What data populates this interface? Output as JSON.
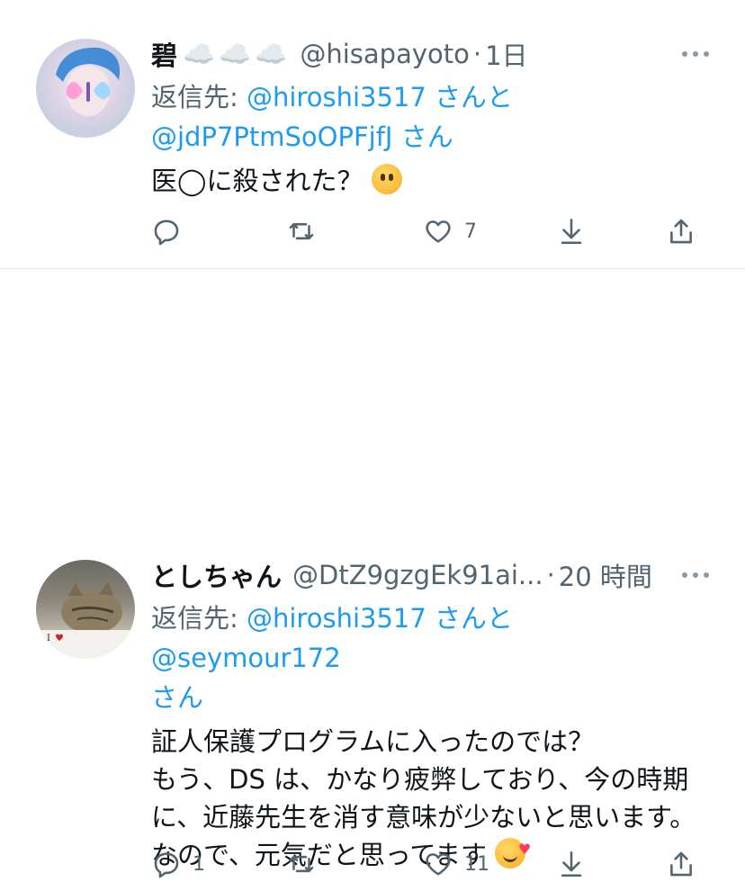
{
  "tweets": [
    {
      "display_name": "碧",
      "name_decoration": "☁️☁️☁️",
      "handle": "@hisapayoto",
      "separator": "·",
      "time": "1日",
      "reply_prefix": "返信先: ",
      "reply_line1_user": "@hiroshi3517",
      "reply_line1_suffix": " さんと",
      "reply_line2_user": "@jdP7PtmSoOPFjfJ",
      "reply_line2_suffix": " さん",
      "text": "医◯に殺された？",
      "emoji": "neutral-face-emoji",
      "actions": {
        "reply_count": "",
        "retweet_count": "",
        "like_count": "7"
      }
    },
    {
      "display_name": "としちゃん",
      "handle": "@DtZ9gzgEk91ai...",
      "separator": "·",
      "time": "20 時間",
      "reply_prefix": "返信先: ",
      "reply_line1_user": "@hiroshi3517",
      "reply_line1_suffix": " さんと ",
      "reply_line1_user2": "@seymour172",
      "reply_line2_suffix": "さん",
      "text_lines": [
        "証人保護プログラムに入ったのでは？",
        "もう、DS は、かなり疲弊しており、今の時期",
        "に、近藤先生を消す意味が少ないと思います。",
        "なので、元気だと思ってます"
      ],
      "emoji": "smiling-face-with-hearts-emoji",
      "actions": {
        "reply_count": "1",
        "retweet_count": "",
        "like_count": "11"
      }
    }
  ],
  "colors": {
    "link": "#1d9bf0",
    "muted": "#536471",
    "text": "#0f1419",
    "divider": "#e3e6e8"
  }
}
